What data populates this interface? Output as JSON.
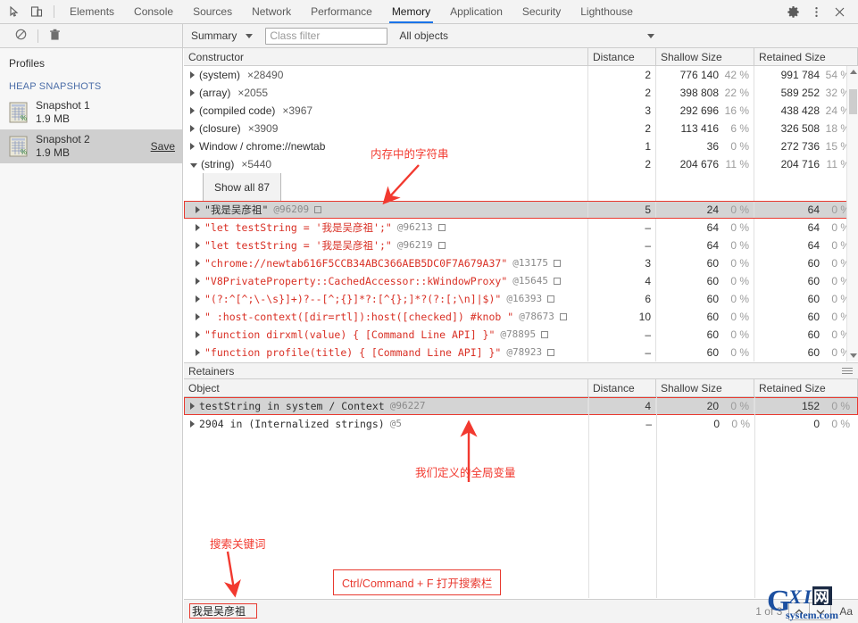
{
  "devtools": {
    "tabs": [
      {
        "label": "Elements",
        "active": false
      },
      {
        "label": "Console",
        "active": false
      },
      {
        "label": "Sources",
        "active": false
      },
      {
        "label": "Network",
        "active": false
      },
      {
        "label": "Performance",
        "active": false
      },
      {
        "label": "Memory",
        "active": true
      },
      {
        "label": "Application",
        "active": false
      },
      {
        "label": "Security",
        "active": false
      },
      {
        "label": "Lighthouse",
        "active": false
      }
    ],
    "right_icons": [
      "gear-icon",
      "more-vertical-icon",
      "close-icon"
    ],
    "dock_icons": [
      "inspect-element-icon",
      "device-toolbar-icon"
    ]
  },
  "toolbar": {
    "record_icon": "record-circle-icon",
    "clear_icon": "no-entry-icon",
    "delete_icon": "trash-icon",
    "view_select": "Summary",
    "class_filter_placeholder": "Class filter",
    "class_filter_value": "",
    "objects_select": "All objects"
  },
  "sidebar": {
    "title": "Profiles",
    "section": "HEAP SNAPSHOTS",
    "snapshots": [
      {
        "name": "Snapshot 1",
        "size": "1.9 MB",
        "selected": false,
        "save_label": ""
      },
      {
        "name": "Snapshot 2",
        "size": "1.9 MB",
        "selected": true,
        "save_label": "Save"
      }
    ]
  },
  "grid": {
    "columns": [
      "Constructor",
      "Distance",
      "Shallow Size",
      "Retained Size"
    ],
    "rows": [
      {
        "name": "(system)",
        "count": "×28490",
        "expander": "collapsed",
        "distance": "2",
        "shallow": "776 140",
        "shallow_pct": "42 %",
        "retained": "991 784",
        "retained_pct": "54 %",
        "style": "plain"
      },
      {
        "name": "(array)",
        "count": "×2055",
        "expander": "collapsed",
        "distance": "2",
        "shallow": "398 808",
        "shallow_pct": "22 %",
        "retained": "589 252",
        "retained_pct": "32 %",
        "style": "plain"
      },
      {
        "name": "(compiled code)",
        "count": "×3967",
        "expander": "collapsed",
        "distance": "3",
        "shallow": "292 696",
        "shallow_pct": "16 %",
        "retained": "438 428",
        "retained_pct": "24 %",
        "style": "plain"
      },
      {
        "name": "(closure)",
        "count": "×3909",
        "expander": "collapsed",
        "distance": "2",
        "shallow": "113 416",
        "shallow_pct": "6 %",
        "retained": "326 508",
        "retained_pct": "18 %",
        "style": "plain"
      },
      {
        "name": "Window / chrome://newtab",
        "count": "",
        "expander": "collapsed",
        "distance": "1",
        "shallow": "36",
        "shallow_pct": "0 %",
        "retained": "272 736",
        "retained_pct": "15 %",
        "style": "plain"
      },
      {
        "name": "(string)",
        "count": "×5440",
        "expander": "expanded",
        "distance": "2",
        "shallow": "204 676",
        "shallow_pct": "11 %",
        "retained": "204 716",
        "retained_pct": "11 %",
        "style": "plain"
      }
    ],
    "show_all_button": "Show all 87",
    "string_rows": [
      {
        "text": "\"我是吴彦祖\"",
        "id": "@96209",
        "distance": "5",
        "shallow": "24",
        "shallow_pct": "0 %",
        "retained": "64",
        "retained_pct": "0 %",
        "selected": true,
        "highlight": true
      },
      {
        "text": "\"let testString = '我是吴彦祖';\"",
        "id": "@96213",
        "distance": "–",
        "shallow": "64",
        "shallow_pct": "0 %",
        "retained": "64",
        "retained_pct": "0 %",
        "selected": false,
        "highlight": false
      },
      {
        "text": "\"let testString = '我是吴彦祖';\"",
        "id": "@96219",
        "distance": "–",
        "shallow": "64",
        "shallow_pct": "0 %",
        "retained": "64",
        "retained_pct": "0 %",
        "selected": false,
        "highlight": false
      },
      {
        "text": "\"chrome://newtab616F5CCB34ABC366AEB5DC0F7A679A37\"",
        "id": "@13175",
        "distance": "3",
        "shallow": "60",
        "shallow_pct": "0 %",
        "retained": "60",
        "retained_pct": "0 %",
        "selected": false,
        "highlight": false
      },
      {
        "text": "\"V8PrivateProperty::CachedAccessor::kWindowProxy\"",
        "id": "@15645",
        "distance": "4",
        "shallow": "60",
        "shallow_pct": "0 %",
        "retained": "60",
        "retained_pct": "0 %",
        "selected": false,
        "highlight": false
      },
      {
        "text": "\"(?:^[^;\\-\\s}]+)?--[^;{}]*?:[^{};]*?(?:[;\\n]|$)\"",
        "id": "@16393",
        "distance": "6",
        "shallow": "60",
        "shallow_pct": "0 %",
        "retained": "60",
        "retained_pct": "0 %",
        "selected": false,
        "highlight": false
      },
      {
        "text": "\" :host-context([dir=rtl]):host([checked]) #knob \"",
        "id": "@78673",
        "distance": "10",
        "shallow": "60",
        "shallow_pct": "0 %",
        "retained": "60",
        "retained_pct": "0 %",
        "selected": false,
        "highlight": false
      },
      {
        "text": "\"function dirxml(value) { [Command Line API] }\"",
        "id": "@78895",
        "distance": "–",
        "shallow": "60",
        "shallow_pct": "0 %",
        "retained": "60",
        "retained_pct": "0 %",
        "selected": false,
        "highlight": false
      },
      {
        "text": "\"function profile(title) { [Command Line API] }\"",
        "id": "@78923",
        "distance": "–",
        "shallow": "60",
        "shallow_pct": "0 %",
        "retained": "60",
        "retained_pct": "0 %",
        "selected": false,
        "highlight": false
      }
    ]
  },
  "retainers": {
    "title": "Retainers",
    "columns": [
      "Object",
      "Distance",
      "Shallow Size",
      "Retained Size"
    ],
    "rows": [
      {
        "text": "testString in system / Context",
        "id": "@96227",
        "distance": "4",
        "shallow": "20",
        "shallow_pct": "0 %",
        "retained": "152",
        "retained_pct": "0 %",
        "selected": true,
        "highlight": true,
        "prefix": ""
      },
      {
        "text": "2904 in (Internalized strings)",
        "id": "@5",
        "distance": "–",
        "shallow": "0",
        "shallow_pct": "0 %",
        "retained": "0",
        "retained_pct": "0 %",
        "selected": false,
        "highlight": false,
        "prefix": ""
      }
    ]
  },
  "search": {
    "value": "我是吴彦祖",
    "matches": "1 of 3",
    "prev_icon": "chevron-up-icon",
    "next_icon": "chevron-down-icon",
    "match_case_label": "Aa"
  },
  "annotations": [
    {
      "text": "内存中的字符串",
      "name": "annotation-strings-in-memory"
    },
    {
      "text": "我们定义的全局变量",
      "name": "annotation-global-variable"
    },
    {
      "text": "搜索关键词",
      "name": "annotation-search-keyword"
    },
    {
      "text": "Ctrl/Command + F 打开搜索栏",
      "name": "annotation-search-shortcut"
    }
  ],
  "watermark": {
    "main": "GXI网",
    "sub": "system.com"
  },
  "colors": {
    "accent": "#1a73e8",
    "annotation": "#e8392f",
    "string_red": "#d93025",
    "section_blue": "#4c6ea8"
  }
}
